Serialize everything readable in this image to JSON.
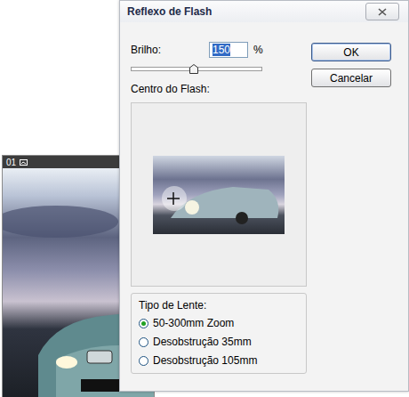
{
  "photo_window": {
    "label": "01"
  },
  "dialog": {
    "title": "Reflexo de Flash"
  },
  "brightness": {
    "label": "Brilho:",
    "value": "150",
    "unit": "%",
    "level": 0.48
  },
  "flash_center": {
    "label": "Centro do Flash:"
  },
  "lens_type": {
    "label": "Tipo de Lente:",
    "options": [
      {
        "label": "50-300mm Zoom",
        "selected": true
      },
      {
        "label": "Desobstrução 35mm",
        "selected": false
      },
      {
        "label": "Desobstrução 105mm",
        "selected": false
      }
    ]
  },
  "buttons": [
    "OK",
    "Cancelar"
  ]
}
